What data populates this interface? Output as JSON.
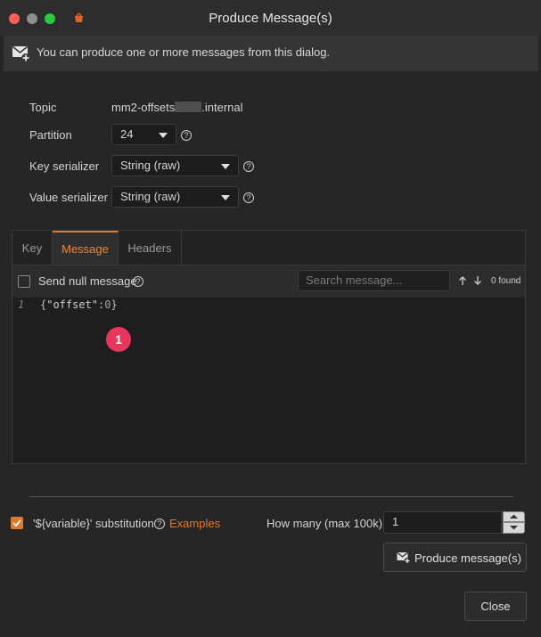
{
  "window": {
    "title": "Produce Message(s)"
  },
  "banner": {
    "icon": "envelope-plus-icon",
    "text": "You can produce one or more messages from this dialog."
  },
  "form": {
    "topic_label": "Topic",
    "topic_value_prefix": "mm2-offsets",
    "topic_value_suffix": ".internal",
    "partition_label": "Partition",
    "partition_value": "24",
    "key_serializer_label": "Key serializer",
    "key_serializer_value": "String (raw)",
    "value_serializer_label": "Value serializer",
    "value_serializer_value": "String (raw)"
  },
  "tabs": [
    {
      "label": "Key"
    },
    {
      "label": "Message"
    },
    {
      "label": "Headers"
    }
  ],
  "message_toolbar": {
    "send_null_label": "Send null message",
    "search_placeholder": "Search message...",
    "found_text": "0 found"
  },
  "editor": {
    "line_number": "1",
    "code_brace_open": "{",
    "code_key": "\"offset\"",
    "code_colon": ":",
    "code_value": "0",
    "code_brace_close": "}"
  },
  "annotation": {
    "badge": "1"
  },
  "footer": {
    "substitution_label": "'${variable}' substitution",
    "examples_link": "Examples",
    "how_many_label": "How many (max 100k):",
    "how_many_value": "1",
    "produce_button": "Produce message(s)",
    "close_button": "Close"
  },
  "colors": {
    "accent": "#e07a2b",
    "badge": "#e8365d",
    "background": "#262626"
  }
}
